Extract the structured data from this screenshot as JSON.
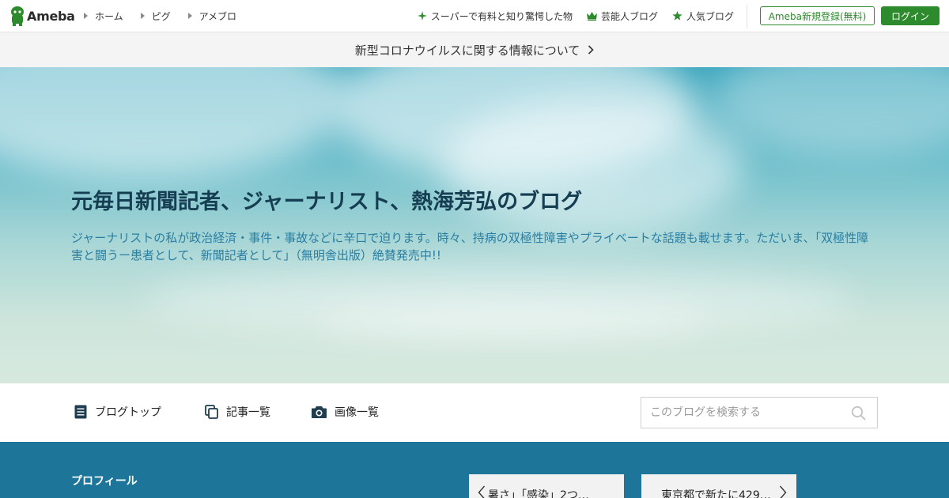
{
  "header": {
    "logo_text": "Ameba",
    "nav": [
      {
        "label": "ホーム"
      },
      {
        "label": "ピグ"
      },
      {
        "label": "アメブロ"
      }
    ],
    "links": [
      {
        "label": "スーパーで有料と知り驚愕した物",
        "icon": "sparkle-icon"
      },
      {
        "label": "芸能人ブログ",
        "icon": "crown-icon"
      },
      {
        "label": "人気ブログ",
        "icon": "star-icon"
      }
    ],
    "register_label": "Ameba新規登録(無料)",
    "login_label": "ログイン",
    "accent_color": "#2d8a2d"
  },
  "notice": {
    "text": "新型コロナウイルスに関する情報について"
  },
  "hero": {
    "title": "元毎日新聞記者、ジャーナリスト、熱海芳弘のブログ",
    "description": "ジャーナリストの私が政治経済・事件・事故などに辛口で迫ります。時々、持病の双極性障害やプライベートな話題も載せます。ただいま、「双極性障害と闘うー患者として、新聞記者として」（無明舎出版）絶賛発売中!!"
  },
  "blognav": {
    "items": [
      {
        "label": "ブログトップ",
        "icon": "document-icon"
      },
      {
        "label": "記事一覧",
        "icon": "copy-icon"
      },
      {
        "label": "画像一覧",
        "icon": "camera-icon"
      }
    ],
    "search_placeholder": "このブログを検索する"
  },
  "footer": {
    "profile_heading": "プロフィール",
    "prev_entry": "暑さ」「感染」2つ…",
    "next_entry": "東京都で新たに429…",
    "band_color": "#1d7699"
  }
}
